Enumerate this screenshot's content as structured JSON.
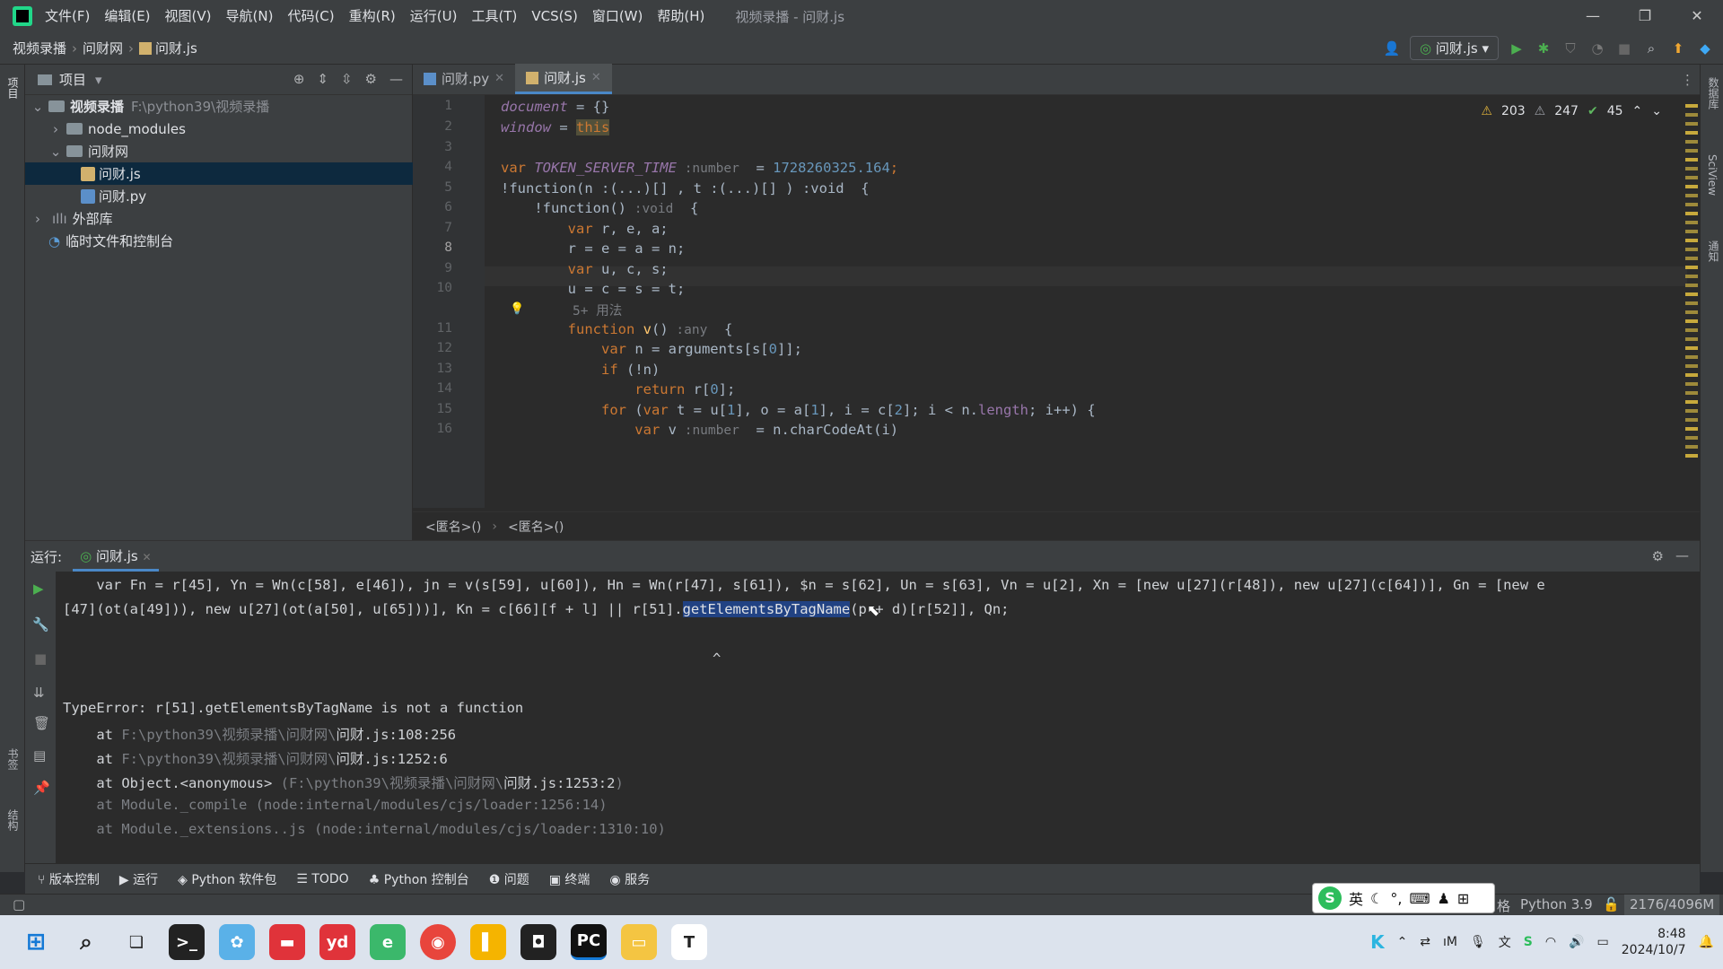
{
  "menu": [
    "文件(F)",
    "编辑(E)",
    "视图(V)",
    "导航(N)",
    "代码(C)",
    "重构(R)",
    "运行(U)",
    "工具(T)",
    "VCS(S)",
    "窗口(W)",
    "帮助(H)"
  ],
  "window_title": "视频录播 - 问财.js",
  "breadcrumbs": [
    "视频录播",
    "问财网",
    "问财.js"
  ],
  "run_config": "问财.js",
  "project": {
    "title": "项目",
    "root": "视频录播",
    "root_path": "F:\\python39\\视频录播",
    "items": [
      "node_modules",
      "问财网",
      "问财.js",
      "问财.py",
      "外部库",
      "临时文件和控制台"
    ]
  },
  "left_strip": [
    "项目",
    "书签",
    "结构"
  ],
  "right_strip": [
    "数据库",
    "SciView",
    "通知"
  ],
  "tabs": [
    "问财.py",
    "问财.js"
  ],
  "inspections": {
    "warn1": "203",
    "warn2": "247",
    "ok": "45"
  },
  "code": {
    "l1a": "document",
    "l1b": " = {}",
    "l2a": "window",
    "l2b": " = ",
    "l2c": "this",
    "l4a": "var ",
    "l4b": "TOKEN_SERVER_TIME",
    "l4c": " :number",
    "l4d": "  = ",
    "l4e": "1728260325.164",
    "l4f": ";",
    "l5": "!function(n :(...)[] , t :(...)[] ) :void  {",
    "l6a": "    !function()",
    "l6b": " :void",
    "l6c": "  {",
    "l7a": "        var",
    "l7b": " r, e, a;",
    "l8": "        r = e = a = n;",
    "l9a": "        var",
    "l9b": " u, c, s;",
    "l10": "        u = c = s = t;",
    "usage": "5+ 用法",
    "l11a": "        function ",
    "l11b": "v",
    "l11c": "()",
    "l11d": " :any",
    "l11e": "  {",
    "l12a": "            var",
    "l12b": " n = arguments[s[",
    "l12c": "0",
    "l12d": "]];",
    "l13a": "            if",
    "l13b": " (!n)",
    "l14a": "                return",
    "l14b": " r[",
    "l14c": "0",
    "l14d": "];",
    "l15a": "            for",
    "l15b": " (",
    "l15c": "var",
    "l15d": " t = u[",
    "l15e": "1",
    "l15f": "], o = a[",
    "l15g": "1",
    "l15h": "], i = c[",
    "l15i": "2",
    "l15j": "]; i < n.",
    "l15k": "length",
    "l15l": "; i++) {",
    "l16a": "                var",
    "l16b": " v",
    "l16c": " :number",
    "l16d": "  = n.charCodeAt(i)"
  },
  "line_numbers": [
    "1",
    "2",
    "3",
    "4",
    "5",
    "6",
    "7",
    "8",
    "9",
    "10",
    "11",
    "12",
    "13",
    "14",
    "15",
    "16"
  ],
  "editor_crumbs": [
    "<匿名>()",
    "<匿名>()"
  ],
  "run": {
    "label": "运行:",
    "tab": "问财.js",
    "o1": "    var Fn = r[45], Yn = Wn(c[58], e[46]), jn = v(s[59], u[60]), Hn = Wn(r[47], s[61]), $n = s[62], Un = s[63], Vn = u[2], Xn = [new u[27](r[48]), new u[27](c[64])], Gn = [new e",
    "o2a": "[47](ot(a[49])), new u[27](ot(a[50], u[65]))], Kn = c[66][f + l] || r[51].",
    "o2b": "getElementsByTagName",
    "o2c": "(p + d)[r[52]], Qn;",
    "caret": "^",
    "err": "TypeError: r[51].getElementsByTagName is not a function",
    "t1a": "    at ",
    "t1b": "F:\\python39\\视频录播\\问财网\\",
    "t1c": "问财.js:108:256",
    "t2a": "    at ",
    "t2b": "F:\\python39\\视频录播\\问财网\\",
    "t2c": "问财.js:1252:6",
    "t3a": "    at Object.<anonymous> ",
    "t3b": "(F:\\python39\\视频录播\\问财网\\",
    "t3c": "问财.js:1253:2",
    "t3d": ")",
    "t4": "    at Module._compile (node:internal/modules/cjs/loader:1256:14)",
    "t5": "    at Module._extensions..js (node:internal/modules/cjs/loader:1310:10)"
  },
  "bottom_tabs": [
    "版本控制",
    "运行",
    "Python 软件包",
    "TODO",
    "Python 控制台",
    "问题",
    "终端",
    "服务"
  ],
  "status": {
    "python": "Python 3.9",
    "memory": "2176/4096M",
    "cut": "格"
  },
  "ime": {
    "lang": "英"
  },
  "clock": {
    "time": "8:48",
    "date": "2024/10/7"
  }
}
